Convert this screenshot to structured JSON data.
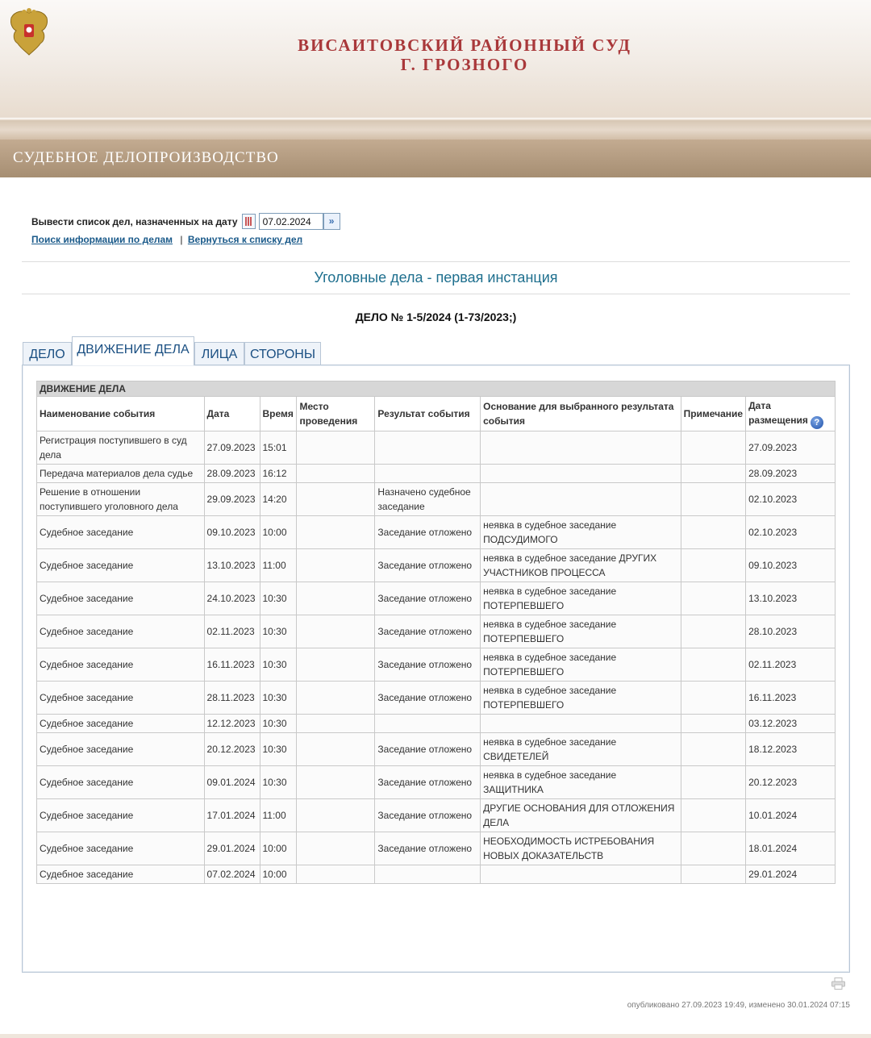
{
  "header": {
    "title_line1": "ВИСАИТОВСКИЙ РАЙОННЫЙ СУД",
    "title_line2": "Г. ГРОЗНОГО",
    "emblem_icon": "coat-of-arms-icon"
  },
  "section": {
    "title": "СУДЕБНОЕ ДЕЛОПРОИЗВОДСТВО"
  },
  "date_filter": {
    "label": "Вывести список дел, назначенных на дату",
    "date_value": "07.02.2024",
    "calendar_icon": "calendar-icon",
    "go_icon": "go-arrow-icon"
  },
  "links": {
    "search": "Поиск информации по делам",
    "separator": "|",
    "back": "Вернуться к списку дел"
  },
  "category_title": "Уголовные дела - первая инстанция",
  "case_title": "ДЕЛО № 1-5/2024 (1-73/2023;)",
  "tabs": [
    {
      "label": "ДЕЛО"
    },
    {
      "label": "ДВИЖЕНИЕ ДЕЛА"
    },
    {
      "label": "ЛИЦА"
    },
    {
      "label": "СТОРОНЫ"
    }
  ],
  "table": {
    "section_title": "ДВИЖЕНИЕ ДЕЛА",
    "columns": [
      "Наименование события",
      "Дата",
      "Время",
      "Место проведения",
      "Результат события",
      "Основание для выбранного результата события",
      "Примечание",
      "Дата размещения"
    ],
    "help_icon": "?",
    "rows": [
      [
        "Регистрация поступившего в суд дела",
        "27.09.2023",
        "15:01",
        "",
        "",
        "",
        "",
        "27.09.2023"
      ],
      [
        "Передача материалов дела судье",
        "28.09.2023",
        "16:12",
        "",
        "",
        "",
        "",
        "28.09.2023"
      ],
      [
        "Решение в отношении поступившего уголовного дела",
        "29.09.2023",
        "14:20",
        "",
        "Назначено судебное заседание",
        "",
        "",
        "02.10.2023"
      ],
      [
        "Судебное заседание",
        "09.10.2023",
        "10:00",
        "",
        "Заседание отложено",
        "неявка в судебное заседание ПОДСУДИМОГО",
        "",
        "02.10.2023"
      ],
      [
        "Судебное заседание",
        "13.10.2023",
        "11:00",
        "",
        "Заседание отложено",
        "неявка в судебное заседание ДРУГИХ УЧАСТНИКОВ ПРОЦЕССА",
        "",
        "09.10.2023"
      ],
      [
        "Судебное заседание",
        "24.10.2023",
        "10:30",
        "",
        "Заседание отложено",
        "неявка в судебное заседание ПОТЕРПЕВШЕГО",
        "",
        "13.10.2023"
      ],
      [
        "Судебное заседание",
        "02.11.2023",
        "10:30",
        "",
        "Заседание отложено",
        "неявка в судебное заседание ПОТЕРПЕВШЕГО",
        "",
        "28.10.2023"
      ],
      [
        "Судебное заседание",
        "16.11.2023",
        "10:30",
        "",
        "Заседание отложено",
        "неявка в судебное заседание ПОТЕРПЕВШЕГО",
        "",
        "02.11.2023"
      ],
      [
        "Судебное заседание",
        "28.11.2023",
        "10:30",
        "",
        "Заседание отложено",
        "неявка в судебное заседание ПОТЕРПЕВШЕГО",
        "",
        "16.11.2023"
      ],
      [
        "Судебное заседание",
        "12.12.2023",
        "10:30",
        "",
        "",
        "",
        "",
        "03.12.2023"
      ],
      [
        "Судебное заседание",
        "20.12.2023",
        "10:30",
        "",
        "Заседание отложено",
        "неявка в судебное заседание СВИДЕТЕЛЕЙ",
        "",
        "18.12.2023"
      ],
      [
        "Судебное заседание",
        "09.01.2024",
        "10:30",
        "",
        "Заседание отложено",
        "неявка в судебное заседание ЗАЩИТНИКА",
        "",
        "20.12.2023"
      ],
      [
        "Судебное заседание",
        "17.01.2024",
        "11:00",
        "",
        "Заседание отложено",
        "ДРУГИЕ ОСНОВАНИЯ ДЛЯ ОТЛОЖЕНИЯ ДЕЛА",
        "",
        "10.01.2024"
      ],
      [
        "Судебное заседание",
        "29.01.2024",
        "10:00",
        "",
        "Заседание отложено",
        "НЕОБХОДИМОСТЬ ИСТРЕБОВАНИЯ НОВЫХ ДОКАЗАТЕЛЬСТВ",
        "",
        "18.01.2024"
      ],
      [
        "Судебное заседание",
        "07.02.2024",
        "10:00",
        "",
        "",
        "",
        "",
        "29.01.2024"
      ]
    ]
  },
  "footer": {
    "print_icon": "printer-icon",
    "published": "опубликовано 27.09.2023 19:49, изменено 30.01.2024 07:15"
  }
}
